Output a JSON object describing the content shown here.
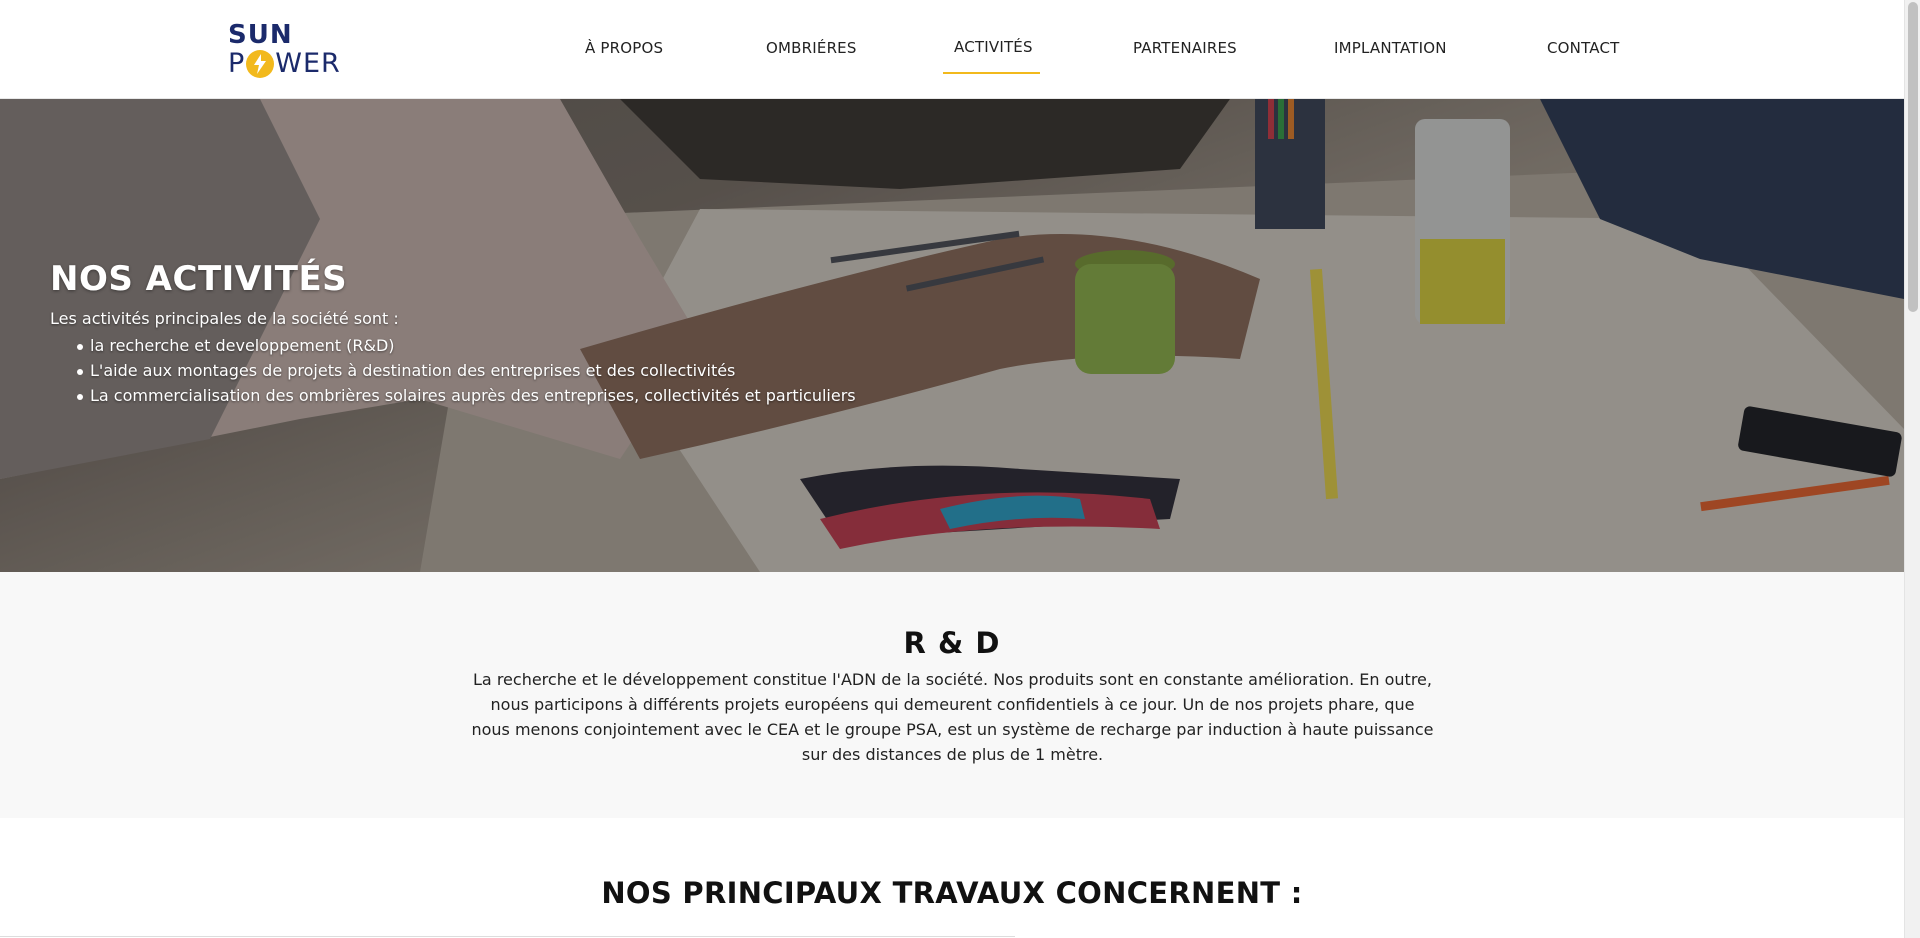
{
  "header": {
    "logo_line1": "SUN",
    "logo_line2_prefix": "P",
    "logo_line2_suffix": "WER",
    "nav": [
      {
        "label": "À PROPOS"
      },
      {
        "label": "OMBRIÉRES"
      },
      {
        "label": "ACTIVITÉS"
      },
      {
        "label": "PARTENAIRES"
      },
      {
        "label": "IMPLANTATION"
      },
      {
        "label": "CONTACT"
      }
    ],
    "active_item": "ACTIVITÉS"
  },
  "hero": {
    "title": "NOS ACTIVITÉS",
    "intro": "Les activités principales de la société sont :",
    "items": [
      "la recherche et developpement (R&D)",
      "L'aide aux montages de projets à destination des entreprises et des collectivités",
      "La commercialisation des ombrières solaires auprès des entreprises, collectivités et particuliers"
    ]
  },
  "rd": {
    "title": "R & D",
    "text": "La recherche et le développement constitue l'ADN de la société. Nos produits sont en constante amélioration. En outre, nous participons à différents projets européens qui demeurent confidentiels à ce jour. Un de nos projets phare, que nous menons conjointement avec le CEA et le groupe PSA, est un système de recharge par induction à haute puissance sur des distances de plus de 1 mètre."
  },
  "travaux": {
    "title": "NOS PRINCIPAUX TRAVAUX CONCERNENT :"
  },
  "colors": {
    "brand_navy": "#1b2a6b",
    "brand_yellow": "#f2b91c",
    "section_bg": "#f8f8f8"
  },
  "icons": {
    "logo_bolt": "lightning-bolt-icon"
  }
}
